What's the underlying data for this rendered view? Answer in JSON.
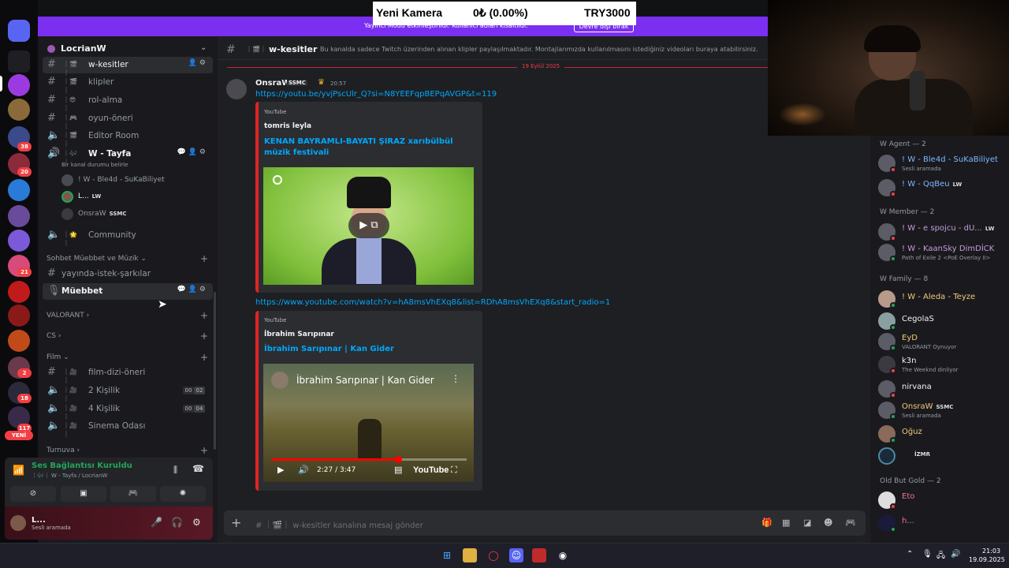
{
  "ticker": {
    "name": "Yeni Kamera",
    "change": "0₺ (0.00%)",
    "price": "TRY3000"
  },
  "banner": {
    "text": "Yayıncı Modu etkinleştirildi. Kullanıcı adları kısaltıldı.",
    "button": "Devre dışı bırak"
  },
  "rail": {
    "badges": [
      "38",
      "20",
      "21",
      "2",
      "18",
      "117"
    ],
    "new_label": "YENİ"
  },
  "guild": {
    "name": "LocrianW"
  },
  "channels": [
    {
      "name": "w-kesitler",
      "emoji": "｜🎬｜"
    },
    {
      "name": "klipler",
      "emoji": "｜🎬｜"
    },
    {
      "name": "rol-alma",
      "emoji": "｜😎｜"
    },
    {
      "name": "oyun-öneri",
      "emoji": "｜🎮｜"
    },
    {
      "name": "Editor Room",
      "emoji": "｜🎬｜"
    },
    {
      "name": "W - Tayfa",
      "emoji": "｜🎶｜",
      "status": "Bir kanal durumu belirle"
    },
    {
      "name": "Community",
      "emoji": "｜🌟｜"
    }
  ],
  "voice_users": [
    {
      "name": "! W - Ble4d - SuKaBiliyet",
      "tag": ""
    },
    {
      "name": "L...",
      "tag": "LW"
    },
    {
      "name": "OnsraW",
      "tag": "SSMC"
    }
  ],
  "categories": {
    "sohbet": "Sohbet Müebbet ve Müzik",
    "valorant": "VALORANT",
    "cs": "CS",
    "film": "Film",
    "turnuva": "Turnuva"
  },
  "sohbet_channels": [
    {
      "name": "yayında-istek-şarkılar"
    },
    {
      "name": "Müebbet"
    }
  ],
  "film_channels": [
    {
      "name": "film-dizi-öneri",
      "emoji": "｜🎥｜"
    },
    {
      "name": "2 Kişilik",
      "emoji": "｜🎥｜",
      "count_a": "00",
      "count_b": "02"
    },
    {
      "name": "4 Kişilik",
      "emoji": "｜🎥｜",
      "count_a": "00",
      "count_b": "04"
    },
    {
      "name": "Sinema Odası",
      "emoji": "｜🎥｜"
    }
  ],
  "voice_panel": {
    "title": "Ses Bağlantısı Kuruldu",
    "sub": "｜🎶｜ W - Tayfa / LocrianW"
  },
  "user_panel": {
    "name": "L...",
    "status": "Sesli aramada"
  },
  "chat_header": {
    "channel": "w-kesitler",
    "emoji": "｜🎬｜",
    "topic": "Bu kanalda sadece Twitch üzerinden alınan klipler paylaşılmaktadır. Montajlarımızda kullanılmasını istediğiniz videoları buraya atabilirsiniz."
  },
  "date_divider": "19 Eylül 2025",
  "message": {
    "author": "OnsraW",
    "tag": "SSMC",
    "time": "20:57",
    "link1": "https://youtu.be/yvjPscUlr_Q?si=N8YEEFqpBEPqAVGP&t=119",
    "link2": "https://www.youtube.com/watch?v=hA8msVhEXq8&list=RDhA8msVhEXq8&start_radio=1"
  },
  "embed1": {
    "provider": "YouTube",
    "author": "tomris leyla",
    "title": "KENAN BAYRAMLI-BAYATI ŞIRAZ   xarıbülbül müzik festivali"
  },
  "embed2": {
    "provider": "YouTube",
    "author": "İbrahim Sarıpınar",
    "title": "İbrahim Sarıpınar | Kan Gider",
    "video_title": "İbrahim Sarıpınar | Kan Gider",
    "time": "2:27 / 3:47",
    "progress": 0.65,
    "logo": "YouTube"
  },
  "composer": {
    "placeholder": "w-kesitler kanalına mesaj gönder",
    "emoji": "｜🎬｜"
  },
  "members": {
    "groups": [
      {
        "label": "W Agent — 2"
      },
      {
        "label": "W Member — 2"
      },
      {
        "label": "W Family — 8"
      },
      {
        "label": "Old But Gold — 2"
      }
    ],
    "agent": [
      {
        "name": "! W - Ble4d - SuKaBiliyet",
        "sub": "Sesli aramada",
        "color": "#7eb6ff"
      },
      {
        "name": "! W - QqBeu",
        "tag": "LW",
        "color": "#7eb6ff"
      }
    ],
    "member": [
      {
        "name": "! W - e spojcu - dU...",
        "tag": "LW",
        "color": "#c79bd9"
      },
      {
        "name": "! W - KaanSky DimDİCK",
        "sub": "Path of Exile 2 <PoE Overlay II>",
        "color": "#c79bd9"
      }
    ],
    "family": [
      {
        "name": "! W - Aleda - Teyze",
        "color": "#f0c97a"
      },
      {
        "name": "CegolaS",
        "color": "#f2f3f5"
      },
      {
        "name": "EyD",
        "sub": "VALORANT Oynuyor",
        "color": "#f0c97a"
      },
      {
        "name": "k3n",
        "sub": "The Weeknd dinliyor",
        "color": "#f2f3f5"
      },
      {
        "name": "nirvana",
        "color": "#f2f3f5"
      },
      {
        "name": "OnsraW",
        "tag": "SSMC",
        "sub": "Sesli aramada",
        "color": "#f0c97a"
      },
      {
        "name": "Oğuz",
        "color": "#f0c97a"
      },
      {
        "name": "",
        "tag": "İZMR",
        "color": "#f2f3f5"
      }
    ],
    "gold": [
      {
        "name": "Eto",
        "color": "#f0708a"
      },
      {
        "name": "h...",
        "color": "#f0708a"
      }
    ]
  },
  "taskbar": {
    "time": "21:03",
    "date": "19.09.2025"
  }
}
